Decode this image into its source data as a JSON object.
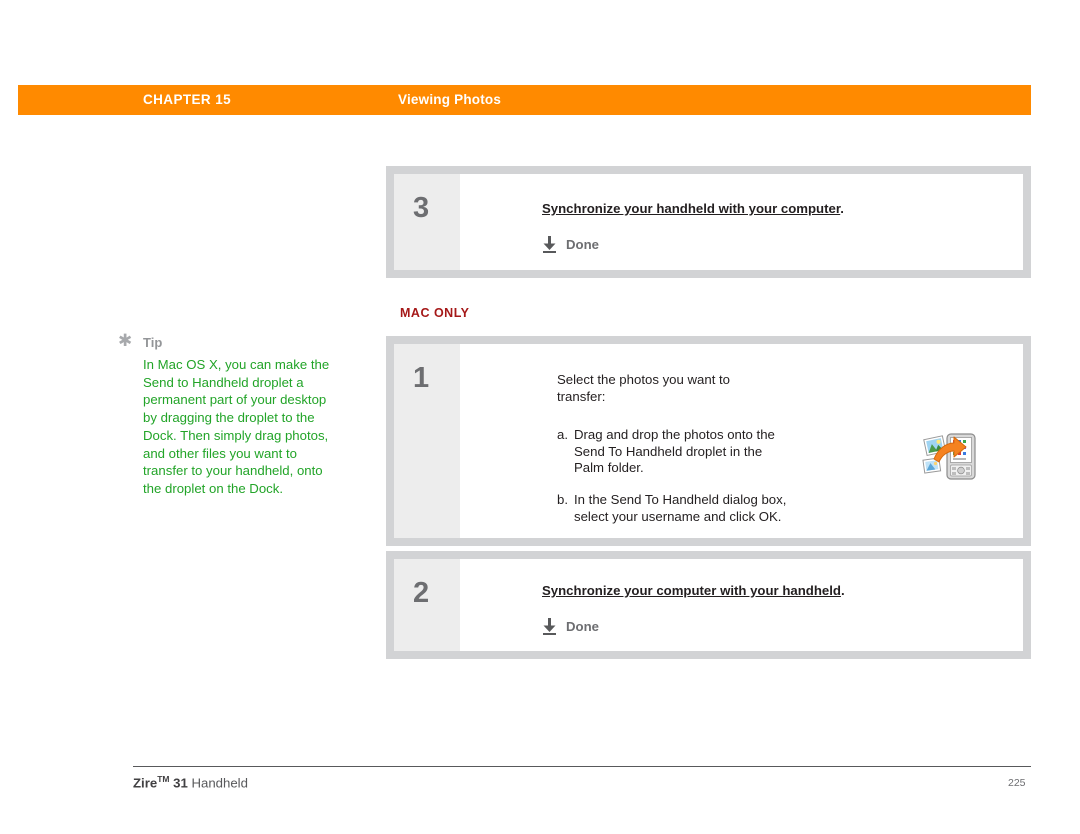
{
  "header": {
    "chapter_label": "CHAPTER 15",
    "section_title": "Viewing Photos",
    "bar_color": "#ff8a00"
  },
  "tip": {
    "icon": "asterisk-icon",
    "label": "Tip",
    "body": "In Mac OS X, you can make the Send to Handheld droplet a permanent part of your desktop by dragging the droplet to the Dock. Then simply drag photos, and other files you want to transfer to your handheld, onto the droplet on the Dock.",
    "text_color": "#22a428"
  },
  "platform_note": {
    "label": "MAC ONLY",
    "color": "#a51818"
  },
  "steps": {
    "top": {
      "number": "3",
      "instruction_underlined": "Synchronize your handheld with your computer",
      "instruction_period": ".",
      "done_icon": "download-arrow-icon",
      "done_label": "Done"
    },
    "mac_one": {
      "number": "1",
      "intro": "Select the photos you want to transfer:",
      "items": [
        {
          "marker": "a.",
          "text": "Drag and drop the photos onto the Send To Handheld droplet in the Palm folder."
        },
        {
          "marker": "b.",
          "text": "In the Send To Handheld dialog box, select your username and click OK."
        }
      ],
      "illustration": "send-to-handheld-droplet-icon"
    },
    "mac_two": {
      "number": "2",
      "instruction_underlined": "Synchronize your computer with your handheld",
      "instruction_period": ".",
      "done_icon": "download-arrow-icon",
      "done_label": "Done"
    }
  },
  "footer": {
    "product_bold": "Zire",
    "product_tm": "TM",
    "product_model": " 31",
    "product_suffix": " Handheld",
    "page_number": "225"
  }
}
